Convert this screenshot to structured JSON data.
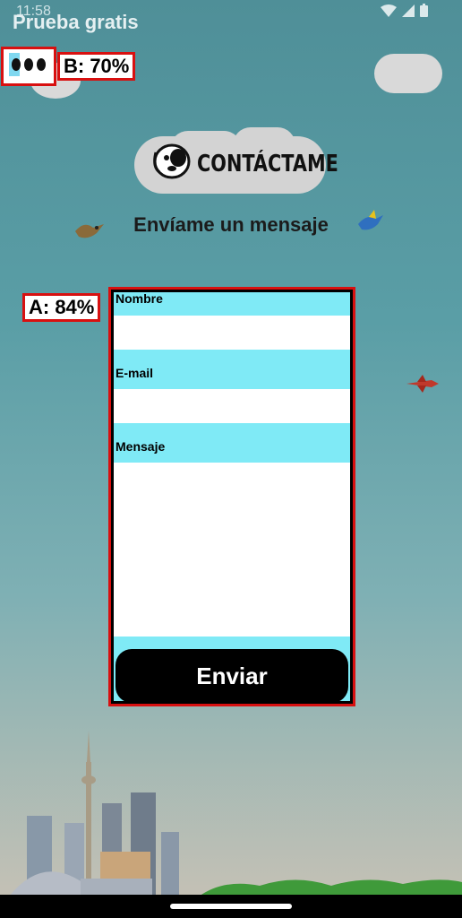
{
  "status_bar": {
    "time": "11:58"
  },
  "app": {
    "title": "Prueba gratis"
  },
  "badges": {
    "b_label": "B: 70%",
    "a_label": "A: 84%"
  },
  "logo": {
    "text": "CONTÁCTAME"
  },
  "heading": "Envíame un mensaje",
  "form": {
    "name_label": "Nombre",
    "email_label": "E-mail",
    "message_label": "Mensaje",
    "submit_label": "Enviar"
  },
  "colors": {
    "label_bar": "#7feaf6",
    "highlight_border": "#d81010",
    "button_bg": "#000000"
  }
}
